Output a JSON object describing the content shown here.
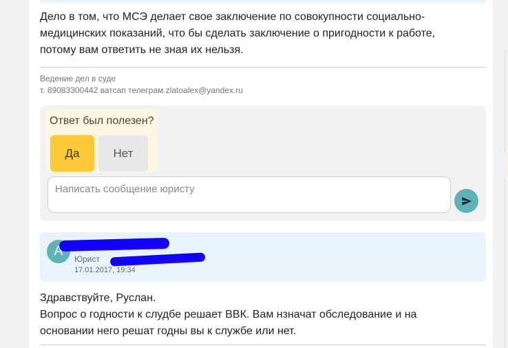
{
  "answer": {
    "lines": [
      "Дело в том, что МСЭ делает свое заключение по совокупности социально-",
      "медицинских показаний, что бы сделать заключение о пригодности к работе,",
      "потому вам ответить не зная их нельзя."
    ],
    "signature": {
      "line1": "Ведение дел в суде",
      "line2": "т. 89083300442 ватсап телеграм zlatoalex@yandex.ru"
    }
  },
  "feedback": {
    "question": "Ответ был полезен?",
    "yes_label": "Да",
    "no_label": "Нет",
    "colors": {
      "yes": "#fbc93a",
      "no": "#e8e8e8",
      "panel": "#fdf6e3"
    }
  },
  "message_input": {
    "placeholder": "Написать сообщение юристу",
    "send_icon": "send-icon",
    "send_color": "#5fb3b8"
  },
  "lawyer": {
    "avatar_letter": "А",
    "role": "Юрист",
    "date": "17.01.2017, 19:34",
    "redaction_color": "#1400ff"
  },
  "reply": {
    "lines": [
      "Здравствуйте, Руслан.",
      "Вопрос о годности к слудбе решает ВВК. Вам нзначат обследование и на",
      "основании него решат годны вы к службе или нет."
    ]
  }
}
